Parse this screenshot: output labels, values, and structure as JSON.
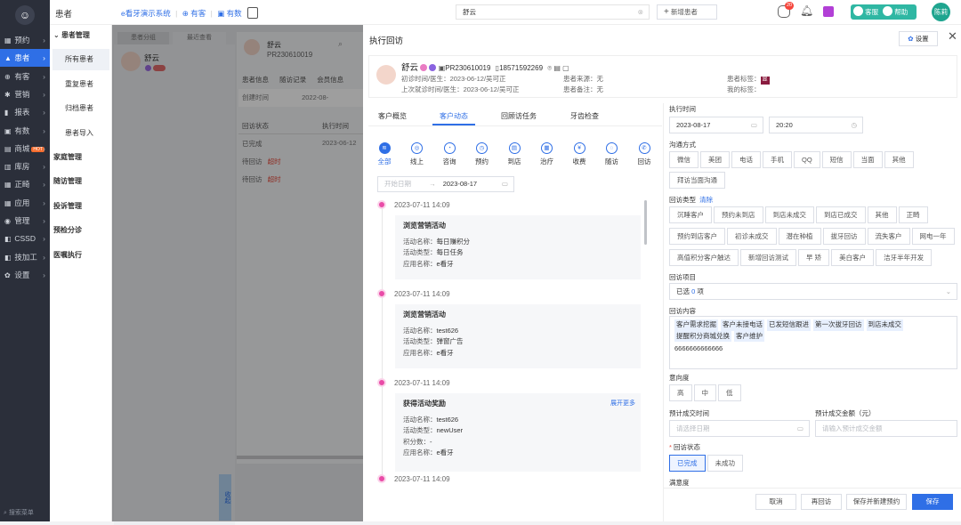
{
  "nav": {
    "items": [
      {
        "icon": "▦",
        "label": "预约"
      },
      {
        "icon": "▲",
        "label": "患者"
      },
      {
        "icon": "⊕",
        "label": "有客"
      },
      {
        "icon": "✱",
        "label": "营销"
      },
      {
        "icon": "▮",
        "label": "报表"
      },
      {
        "icon": "▣",
        "label": "有数"
      },
      {
        "icon": "▤",
        "label": "商城",
        "badge": "HOT"
      },
      {
        "icon": "▥",
        "label": "库房"
      },
      {
        "icon": "▦",
        "label": "正畸"
      },
      {
        "icon": "▦",
        "label": "应用"
      },
      {
        "icon": "◉",
        "label": "管理"
      },
      {
        "icon": "◧",
        "label": "CSSD"
      },
      {
        "icon": "◧",
        "label": "技加工"
      },
      {
        "icon": "✿",
        "label": "设置"
      }
    ],
    "search_menu": "搜索菜单"
  },
  "topbar": {
    "section": "患者",
    "brand": "e看牙演示系统",
    "links": [
      "有客",
      "有数"
    ],
    "search_value": "舒云",
    "new_patient": "新增患者",
    "notice_count": "20",
    "service": "客服",
    "help": "帮助",
    "user": "陈莉"
  },
  "nav2": [
    {
      "type": "grp",
      "label": "患者管理"
    },
    {
      "type": "sub",
      "label": "所有患者",
      "selected": true
    },
    {
      "type": "sub",
      "label": "重复患者"
    },
    {
      "type": "sub",
      "label": "归档患者"
    },
    {
      "type": "sub",
      "label": "患者导入"
    },
    {
      "type": "grp",
      "label": "家庭管理"
    },
    {
      "type": "grp",
      "label": "随访管理"
    },
    {
      "type": "grp",
      "label": "投诉管理"
    },
    {
      "type": "grp",
      "label": "预检分诊"
    },
    {
      "type": "grp",
      "label": "医嘱执行"
    }
  ],
  "bg": {
    "tabs": [
      "患者分组",
      "最近查看"
    ],
    "patient": "舒云",
    "pid": "PR230610019",
    "subtabs": [
      "患者信息",
      "随访记录",
      "会员信息"
    ],
    "create_time_label": "创建时间",
    "create_time": "2022-08-",
    "col1": "回访状态",
    "col2": "执行时间",
    "rows": [
      {
        "status": "已完成",
        "extra": "",
        "date": "2023-06-12"
      },
      {
        "status": "待回访",
        "extra": "超时",
        "date": ""
      },
      {
        "status": "待回访",
        "extra": "超时",
        "date": ""
      }
    ],
    "side_btn": "收起"
  },
  "drawer": {
    "title": "执行回访",
    "settings": "设置",
    "patient": {
      "name": "舒云",
      "pid": "PR230610019",
      "phone": "18571592269",
      "first_visit_label": "初诊时间/医生：",
      "first_visit": "2023-06-12/吴可正",
      "last_visit_label": "上次就诊时间/医生：",
      "last_visit": "2023-06-12/吴可正",
      "source_label": "患者来源：",
      "source": "无",
      "remark_label": "患者备注：",
      "remark": "无",
      "tags_label": "患者标签：",
      "tag": "显",
      "my_tags_label": "我的标签："
    },
    "tabs": [
      "客户概览",
      "客户动态",
      "回顾访任务",
      "牙齿检查"
    ],
    "filters": [
      {
        "icon": "≋",
        "label": "全部"
      },
      {
        "icon": "◎",
        "label": "线上"
      },
      {
        "icon": "◔",
        "label": "咨询"
      },
      {
        "icon": "◷",
        "label": "预约"
      },
      {
        "icon": "▤",
        "label": "到店"
      },
      {
        "icon": "▦",
        "label": "治疗"
      },
      {
        "icon": "¥",
        "label": "收费"
      },
      {
        "icon": "◌",
        "label": "随访"
      },
      {
        "icon": "✆",
        "label": "回访"
      }
    ],
    "date_start_placeholder": "开始日期",
    "date_end": "2023-08-17",
    "timeline": [
      {
        "time": "2023-07-11 14:09",
        "title": "浏览营销活动",
        "lines": [
          [
            "活动名称：",
            "每日赚积分"
          ],
          [
            "活动类型：",
            "每日任务"
          ],
          [
            "应用名称：",
            "e看牙"
          ]
        ]
      },
      {
        "time": "2023-07-11 14:09",
        "title": "浏览营销活动",
        "lines": [
          [
            "活动名称：",
            "test626"
          ],
          [
            "活动类型：",
            "弹窗广告"
          ],
          [
            "应用名称：",
            "e看牙"
          ]
        ]
      },
      {
        "time": "2023-07-11 14:09",
        "title": "获得活动奖励",
        "more": "展开更多",
        "lines": [
          [
            "活动名称：",
            "test626"
          ],
          [
            "活动类型：",
            "newUser"
          ],
          [
            "积分数：",
            "-"
          ],
          [
            "应用名称：",
            "e看牙"
          ]
        ]
      },
      {
        "time": "2023-07-11 14:09",
        "title": "",
        "lines": []
      }
    ],
    "form": {
      "exec_time_label": "执行时间",
      "exec_date": "2023-08-17",
      "exec_time": "20:20",
      "method_label": "沟通方式",
      "methods": [
        "微信",
        "美团",
        "电话",
        "手机",
        "QQ",
        "短信",
        "当面",
        "其他",
        "拜访当面沟通"
      ],
      "type_label": "回访类型",
      "type_clear": "清除",
      "types_row1": [
        "沉睡客户",
        "预约未到店",
        "到店未成交",
        "到店已成交",
        "其他",
        "正畸"
      ],
      "types_row2": [
        "预约到店客户",
        "初诊未成交",
        "潜在种植",
        "拔牙回访",
        "流失客户",
        "网电一年"
      ],
      "types_row3": [
        "高值积分客户触达",
        "新增回访测试",
        "早 矫",
        "美白客户",
        "洁牙半年开发"
      ],
      "items_label": "回访项目",
      "items_value_pre": "已选 ",
      "items_count": "0",
      "items_value_post": " 项",
      "content_label": "回访内容",
      "content_tags": [
        "客户需求挖掘",
        "客户未接电话",
        "已发短信跟进",
        "第一次拔牙回访",
        "到店未成交",
        "提醒积分商城兑换",
        "客户维护"
      ],
      "content_text": "6666666666666",
      "intent_label": "意向度",
      "intents": [
        "高",
        "中",
        "低"
      ],
      "deal_time_label": "预计成交时间",
      "deal_time_placeholder": "请选择日期",
      "deal_amount_label": "预计成交金额（元）",
      "deal_amount_placeholder": "请输入预计成交金额",
      "status_label": "回访状态",
      "statuses": [
        "已完成",
        "未成功"
      ],
      "satisfaction_label": "满意度"
    },
    "footer": [
      "取消",
      "再回访",
      "保存并新建预约",
      "保存"
    ]
  }
}
